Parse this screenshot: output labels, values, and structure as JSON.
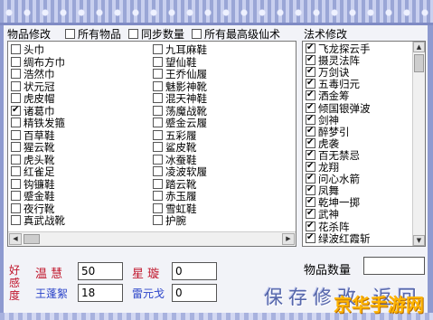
{
  "colors": {
    "frame": "#8e9ad0",
    "red_label": "#c0142a",
    "blue_label": "#2a43c9",
    "watermark": "#ffb400"
  },
  "goods": {
    "section_title": "物品修改",
    "filters": [
      {
        "label": "所有物品",
        "checked": false
      },
      {
        "label": "同步数量",
        "checked": false
      },
      {
        "label": "所有最高级仙术",
        "checked": false
      }
    ],
    "col1": [
      {
        "label": "头巾",
        "checked": false
      },
      {
        "label": "绸布方巾",
        "checked": false
      },
      {
        "label": "浩然巾",
        "checked": false
      },
      {
        "label": "状元冠",
        "checked": false
      },
      {
        "label": "虎皮帽",
        "checked": false
      },
      {
        "label": "诸葛巾",
        "checked": true
      },
      {
        "label": "精铁发箍",
        "checked": false
      },
      {
        "label": "百草鞋",
        "checked": false
      },
      {
        "label": "猩云靴",
        "checked": false
      },
      {
        "label": "虎头靴",
        "checked": false
      },
      {
        "label": "红雀足",
        "checked": false
      },
      {
        "label": "钩镰鞋",
        "checked": false
      },
      {
        "label": "蹙金鞋",
        "checked": false
      },
      {
        "label": "夜行靴",
        "checked": false
      },
      {
        "label": "真武战靴",
        "checked": false
      }
    ],
    "col2": [
      {
        "label": "九耳麻鞋",
        "checked": false
      },
      {
        "label": "望仙鞋",
        "checked": false
      },
      {
        "label": "王乔仙履",
        "checked": false
      },
      {
        "label": "魅影神靴",
        "checked": false
      },
      {
        "label": "混天神鞋",
        "checked": false
      },
      {
        "label": "荡魔战靴",
        "checked": false
      },
      {
        "label": "蹙金云履",
        "checked": false
      },
      {
        "label": "五彩履",
        "checked": false
      },
      {
        "label": "鲨皮靴",
        "checked": false
      },
      {
        "label": "冰蚕鞋",
        "checked": false
      },
      {
        "label": "凌波软履",
        "checked": false
      },
      {
        "label": "踏云靴",
        "checked": false
      },
      {
        "label": "赤玉履",
        "checked": false
      },
      {
        "label": "雪虹鞋",
        "checked": false
      },
      {
        "label": "护腕",
        "checked": false
      }
    ]
  },
  "spells": {
    "section_title": "法术修改",
    "items": [
      {
        "label": "飞龙探云手",
        "checked": true
      },
      {
        "label": "摄灵法阵",
        "checked": true
      },
      {
        "label": "万剑诀",
        "checked": true
      },
      {
        "label": "五毒归元",
        "checked": true
      },
      {
        "label": "洒金筹",
        "checked": true
      },
      {
        "label": "倾国银弹波",
        "checked": true
      },
      {
        "label": "剑神",
        "checked": true
      },
      {
        "label": "醉梦引",
        "checked": true
      },
      {
        "label": "虎袭",
        "checked": true
      },
      {
        "label": "百无禁忌",
        "checked": true
      },
      {
        "label": "龙翔",
        "checked": true
      },
      {
        "label": "问心水箭",
        "checked": true
      },
      {
        "label": "凤舞",
        "checked": true
      },
      {
        "label": "乾坤一掷",
        "checked": true
      },
      {
        "label": "武神",
        "checked": true
      },
      {
        "label": "花杀阵",
        "checked": true
      },
      {
        "label": "绿波红霞斩",
        "checked": true
      }
    ]
  },
  "affection": {
    "vertical_label": [
      "好",
      "感",
      "度"
    ],
    "fields": [
      {
        "name": "温 慧",
        "value": "50"
      },
      {
        "name": "星 璇",
        "value": "0"
      },
      {
        "name": "王蓬絮",
        "value": "18"
      },
      {
        "name": "雷元戈",
        "value": "0"
      }
    ]
  },
  "quantity": {
    "label": "物品数量",
    "value": ""
  },
  "actions": {
    "label": "保存修改 返回"
  },
  "watermark": "京华手游网"
}
